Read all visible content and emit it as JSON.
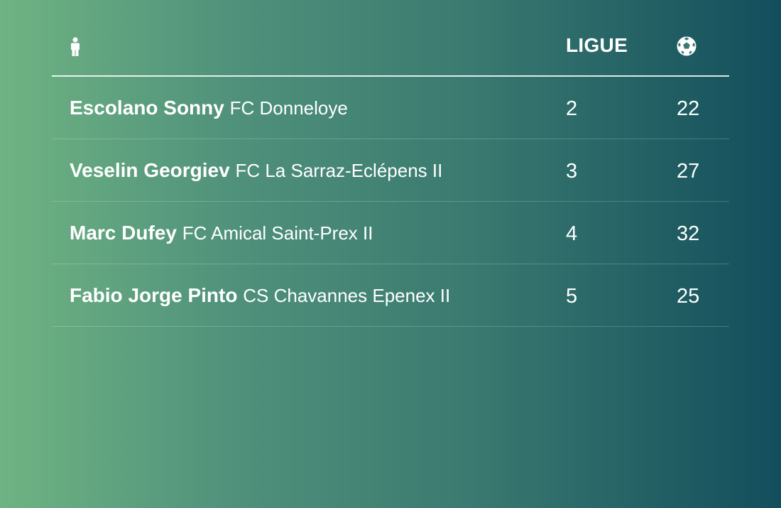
{
  "header": {
    "player_icon": "person-icon",
    "ligue_label": "LIGUE",
    "goals_icon": "soccer-ball-icon"
  },
  "rows": [
    {
      "player": "Escolano Sonny",
      "club": "FC Donneloye",
      "ligue": "2",
      "goals": "22"
    },
    {
      "player": "Veselin Georgiev",
      "club": "FC La Sarraz-Eclépens II",
      "ligue": "3",
      "goals": "27"
    },
    {
      "player": "Marc Dufey",
      "club": "FC Amical Saint-Prex II",
      "ligue": "4",
      "goals": "32"
    },
    {
      "player": "Fabio Jorge Pinto",
      "club": "CS Chavannes Epenex II",
      "ligue": "5",
      "goals": "25"
    }
  ],
  "colors": {
    "gradient_start": "#6fb383",
    "gradient_end": "#124e5c",
    "text": "#ffffff"
  }
}
